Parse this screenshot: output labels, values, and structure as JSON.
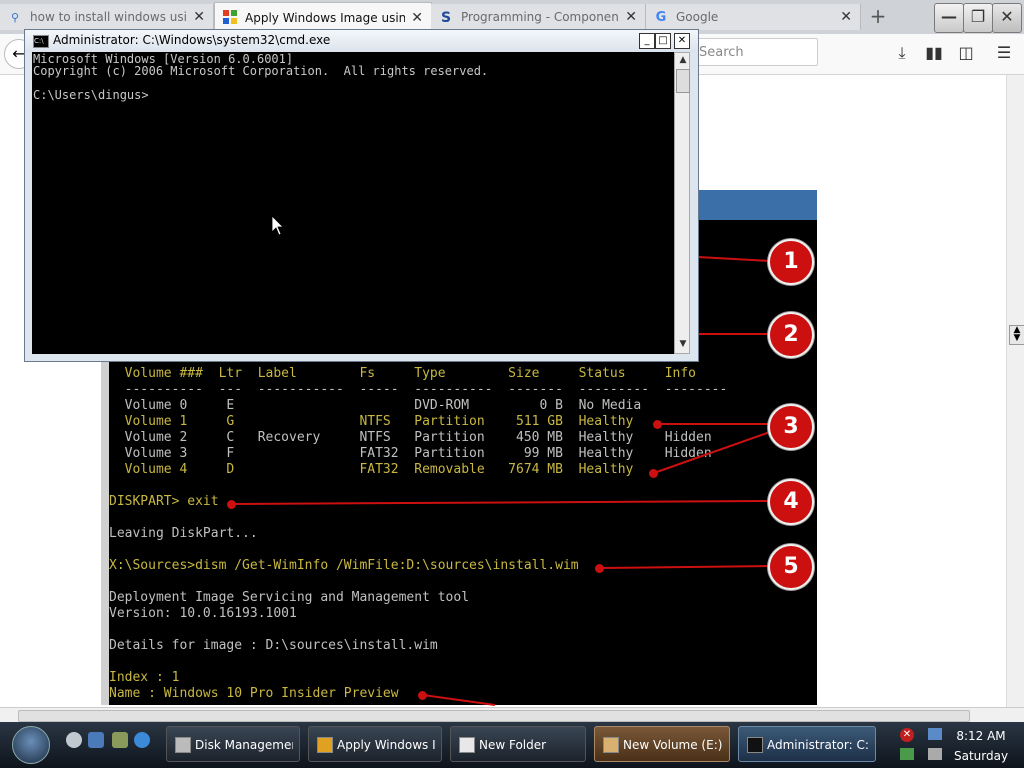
{
  "browser": {
    "tabs": [
      {
        "label": "how to install windows using",
        "icon": "search-icon"
      },
      {
        "label": "Apply Windows Image using",
        "icon": "windows-logo-icon",
        "active": true
      },
      {
        "label": "Programming - Component",
        "icon": "s-logo-icon"
      },
      {
        "label": "Google",
        "icon": "google-icon"
      }
    ],
    "new_tab": "+",
    "search_placeholder": "Search"
  },
  "video": {
    "markers": [
      "1",
      "2",
      "3",
      "4",
      "5"
    ],
    "table_header": "  Volume ###  Ltr  Label        Fs     Type        Size     Status     Info",
    "table_rule": "  ----------  ---  -----------  -----  ----------  -------  ---------  --------",
    "rows": [
      "  Volume 0     E                       DVD-ROM         0 B  No Media",
      "  Volume 1     G                NTFS   Partition    511 GB  Healthy",
      "  Volume 2     C   Recovery     NTFS   Partition    450 MB  Healthy    Hidden",
      "  Volume 3     F                FAT32  Partition     99 MB  Healthy    Hidden",
      "  Volume 4     D                FAT32  Removable   7674 MB  Healthy"
    ],
    "cmd_exit": "DISKPART> exit",
    "leaving": "Leaving DiskPart...",
    "dism_cmd": "X:\\Sources>dism /Get-WimInfo /WimFile:D:\\sources\\install.wim",
    "dism_line1": "Deployment Image Servicing and Management tool",
    "dism_line2": "Version: 10.0.16193.1001",
    "details": "Details for image : D:\\sources\\install.wim",
    "index": "Index : 1",
    "name": "Name : Windows 10 Pro Insider Preview"
  },
  "cmd": {
    "title": "Administrator: C:\\Windows\\system32\\cmd.exe",
    "line1": "Microsoft Windows [Version 6.0.6001]",
    "line2": "Copyright (c) 2006 Microsoft Corporation.  All rights reserved.",
    "prompt": "C:\\Users\\dingus>"
  },
  "taskbar": {
    "buttons": [
      {
        "label": "Disk Management"
      },
      {
        "label": "Apply Windows I..."
      },
      {
        "label": "New Folder"
      },
      {
        "label": "New Volume (E:)"
      },
      {
        "label": "Administrator: C:..."
      }
    ],
    "time": "8:12 AM",
    "day": "Saturday"
  }
}
